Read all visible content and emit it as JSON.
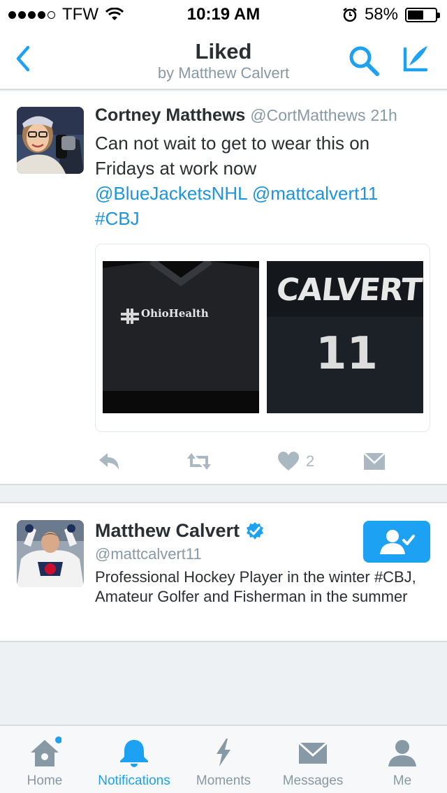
{
  "status_bar": {
    "carrier": "TFW",
    "time": "10:19 AM",
    "battery_percent": "58%",
    "battery_level": 0.58
  },
  "header": {
    "title": "Liked",
    "subtitle": "by Matthew Calvert",
    "back_icon": "chevron-left-icon",
    "search_icon": "search-icon",
    "compose_icon": "compose-icon"
  },
  "tweet": {
    "name": "Cortney Matthews",
    "handle": "@CortMatthews",
    "time": "21h",
    "text_line1": "Can not wait to get to wear this on",
    "text_line2": "Fridays at work now",
    "mention1": "@BlueJacketsNHL",
    "mention2": "@mattcalvert11",
    "hashtag": "#CBJ",
    "photo_left_text": "OhioHealth",
    "photo_right_name": "CALVERT",
    "photo_right_number": "11",
    "like_count": "2"
  },
  "user_card": {
    "name": "Matthew Calvert",
    "handle": "@mattcalvert11",
    "bio": "Professional Hockey Player in the winter #CBJ, Amateur Golfer and Fisherman in the summer",
    "verified": true
  },
  "tabbar": {
    "tabs": [
      {
        "label": "Home",
        "icon": "home-icon",
        "active": false,
        "badge": true
      },
      {
        "label": "Notifications",
        "icon": "bell-icon",
        "active": true
      },
      {
        "label": "Moments",
        "icon": "lightning-icon",
        "active": false
      },
      {
        "label": "Messages",
        "icon": "envelope-icon",
        "active": false
      },
      {
        "label": "Me",
        "icon": "person-icon",
        "active": false
      }
    ]
  },
  "colors": {
    "accent": "#1da1f2",
    "link": "#1b95e0",
    "muted": "#8899a6",
    "text": "#292f33"
  }
}
